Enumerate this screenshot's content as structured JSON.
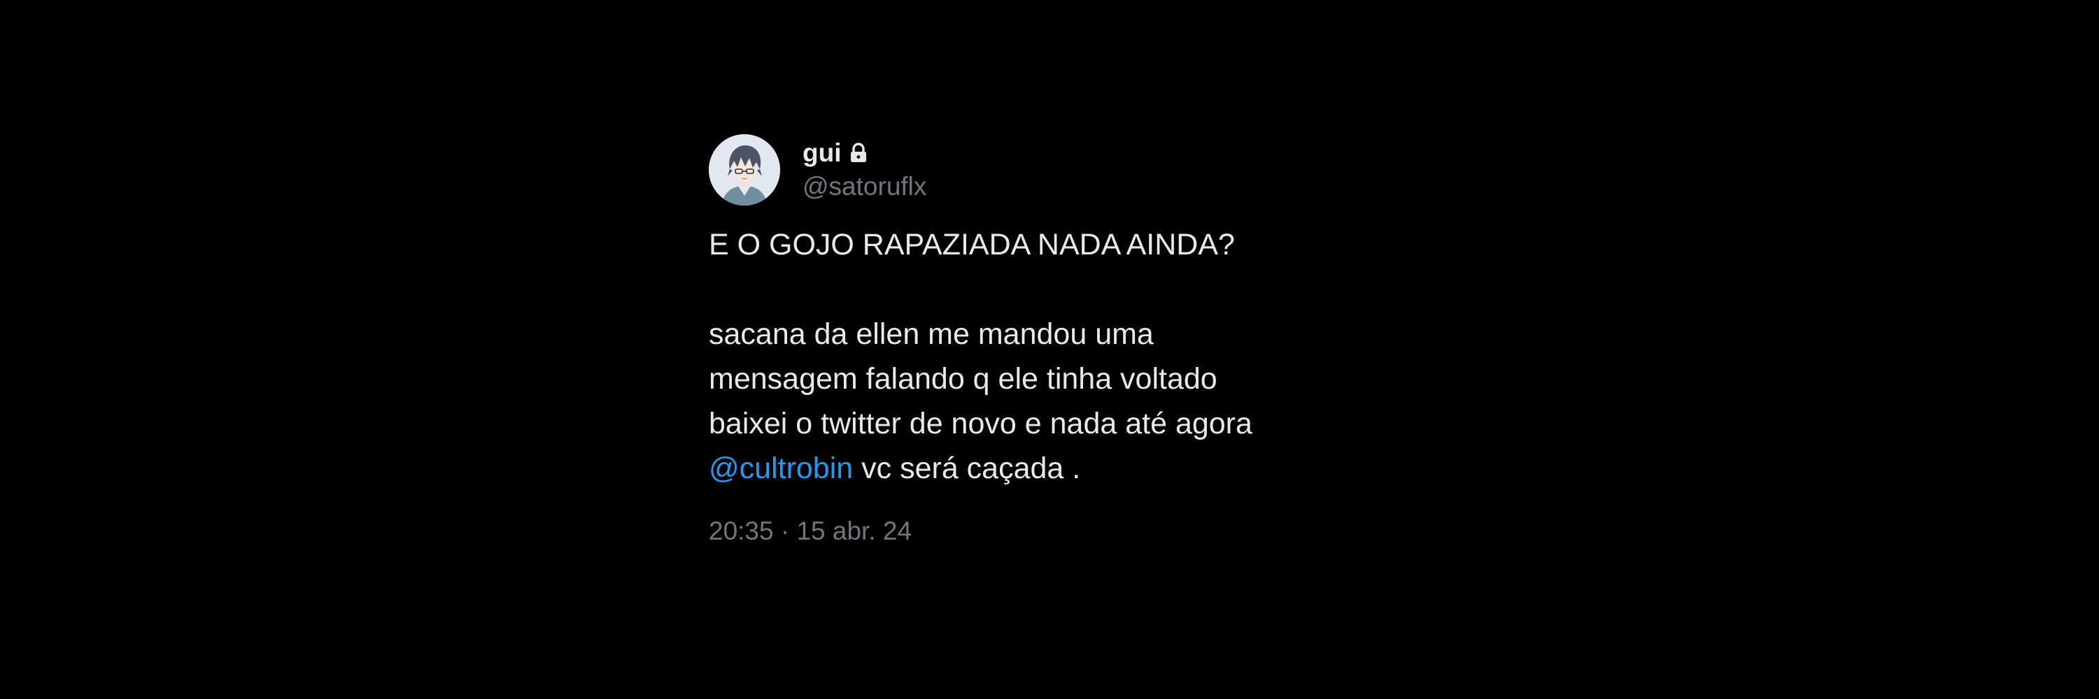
{
  "tweet": {
    "display_name": "gui",
    "handle": "@satoruflx",
    "line1": "E O GOJO RAPAZIADA NADA AINDA?",
    "line2": "sacana da ellen me mandou uma",
    "line3": "mensagem falando q ele tinha voltado",
    "line4": "baixei o twitter de novo e nada até agora",
    "mention": "@cultrobin",
    "line5_rest": " vc será caçada .",
    "timestamp": "20:35 · 15 abr. 24"
  },
  "colors": {
    "background": "#000000",
    "primary_text": "#e7e9ea",
    "secondary_text": "#71767b",
    "mention": "#1d9bf0"
  },
  "icons": {
    "lock": "lock-icon",
    "avatar": "anime-avatar-icon"
  }
}
